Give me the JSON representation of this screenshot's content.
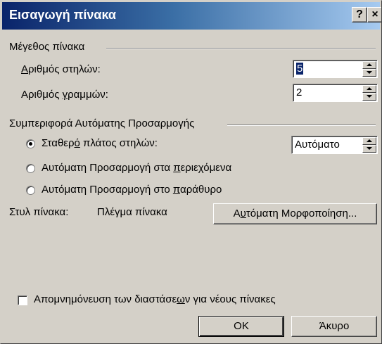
{
  "window": {
    "title": "Εισαγωγή πίνακα",
    "help_label": "?",
    "close_label": "×"
  },
  "table_size": {
    "group_label": "Μέγεθος πίνακα",
    "columns": {
      "label_pre": "",
      "label_key": "Α",
      "label_post": "ριθμός στηλών:",
      "value": "5"
    },
    "rows": {
      "label_pre": "Αριθμός ",
      "label_key": "γ",
      "label_post": "ραμμών:",
      "value": "2"
    }
  },
  "autofit": {
    "group_label": "Συμπεριφορά Αυτόματης Προσαρμογής",
    "fixed": {
      "label_pre": "Σταθερ",
      "label_key": "ό",
      "label_post": " πλάτος στηλών:",
      "selected": true,
      "value": "Αυτόματο"
    },
    "contents": {
      "label_pre": "Αυτόματη Προσαρμογή στα ",
      "label_key": "π",
      "label_post": "εριεχόμενα",
      "selected": false
    },
    "window": {
      "label_pre": "Αυτόματη Προσαρμογή στο ",
      "label_key": "π",
      "label_post": "αράθυρο",
      "selected": false
    }
  },
  "style": {
    "label": "Στυλ πίνακα:",
    "value": "Πλέγμα πίνακα",
    "autoformat": {
      "label_pre": "Α",
      "label_key": "υ",
      "label_post": "τόματη Μορφοποίηση..."
    }
  },
  "remember": {
    "label_pre": "Απομνημόνευση των διαστάσε",
    "label_key": "ω",
    "label_post": "ν για νέους πίνακες",
    "checked": false
  },
  "buttons": {
    "ok": "OK",
    "cancel": "Άκυρο"
  }
}
